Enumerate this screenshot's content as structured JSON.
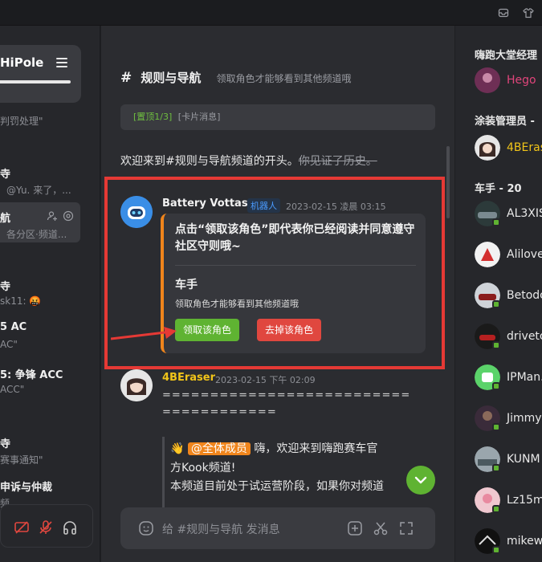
{
  "server": {
    "name": "HiPole",
    "partial_text_1": "判罚处理\""
  },
  "left_channels": [
    {
      "title": "",
      "sub": "@Yu. 来了，..."
    },
    {
      "title": "航",
      "sub": "各分区·频道..."
    },
    {
      "title": "",
      "sub": "sk11: 🤬"
    },
    {
      "title": "5 AC",
      "sub": "AC\""
    },
    {
      "title": "5: 争锋 ACC",
      "sub": "ACC\""
    },
    {
      "title": "",
      "sub": "赛事通知\""
    },
    {
      "title": "申诉与仲裁",
      "sub": "频"
    }
  ],
  "channel": {
    "hash": "#",
    "name": "规则与导航",
    "description": "领取角色才能够看到其他频道哦"
  },
  "pinned": {
    "index": "[置顶1/3]",
    "type": "[卡片消息]"
  },
  "welcome": {
    "text": "欢迎来到#规则与导航频道的开头。",
    "strike": "你见证了历史。"
  },
  "messages": [
    {
      "author": "Battery Vottas",
      "badge": "机器人",
      "time": "2023-02-15 凌晨 03:15",
      "card": {
        "title": "点击“领取该角色”即代表你已经阅读并同意遵守社区守则哦~",
        "role": "车手",
        "role_desc": "领取角色才能够看到其他频道哦",
        "claim_button": "领取该角色",
        "remove_button": "去掉该角色"
      }
    },
    {
      "author": "4BEraser",
      "time": "2023-02-15 下午 02:09",
      "line1": "==========================",
      "line2": "============",
      "emoji": "👋",
      "mention": "@全体成员",
      "text1": "嗨，欢迎来到嗨跑赛车官",
      "text2": "方Kook频道!",
      "text3": "本频道目前处于试运营阶段，如果你对频道"
    }
  ],
  "input": {
    "placeholder": "给 #规则与导航 发消息"
  },
  "right": {
    "groups": [
      {
        "title": "嗨跑大堂经理"
      },
      {
        "title": "涂装管理员 -"
      },
      {
        "title": "车手 - 20"
      }
    ],
    "members": [
      {
        "name": "Hego",
        "color": "#e0457b"
      },
      {
        "name": "4BEras",
        "color": "#f0c419"
      },
      {
        "name": "AL3XIS",
        "color": "#e8e8e8"
      },
      {
        "name": "Alilove",
        "color": "#e8e8e8"
      },
      {
        "name": "Betodc",
        "color": "#e8e8e8"
      },
      {
        "name": "drivetc",
        "color": "#e8e8e8"
      },
      {
        "name": "IPMan.",
        "color": "#e8e8e8"
      },
      {
        "name": "Jimmy",
        "color": "#e8e8e8"
      },
      {
        "name": "KUNM",
        "color": "#e8e8e8"
      },
      {
        "name": "Lz15m",
        "color": "#e8e8e8"
      },
      {
        "name": "mikew",
        "color": "#e8e8e8"
      }
    ]
  },
  "colors": {
    "accent": "#5fb332",
    "highlight": "#e53935",
    "card_border": "#f0851c"
  }
}
